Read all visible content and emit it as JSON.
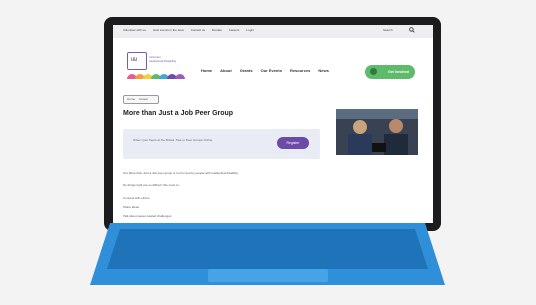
{
  "topbar": {
    "nav": [
      "Volunteer with us",
      "Host events in the area",
      "Contact us",
      "Donate",
      "Careers",
      "Login"
    ],
    "search_label": "Search"
  },
  "logo": {
    "box_text": "i&i",
    "line1": "Inclusion",
    "line2": "Intellectual Disability"
  },
  "mainnav": {
    "items": [
      "Home",
      "About",
      "Grants",
      "Our Events",
      "Resources",
      "News"
    ],
    "cta_label": "Get Involved"
  },
  "breadcrumb": {
    "items": [
      "Home",
      "Career"
    ]
  },
  "main": {
    "title": "More than Just a Job Peer Group",
    "banner_text": "When I join Peers at the Bristol, Tate or Peer Groups Online",
    "register_label": "Register",
    "intro": "Our More than Just a Job peer group is run for and by people with intellectual disability.",
    "prompt": "Do things right are so difficult. We meet to:",
    "bullets": [
      "Connect with others",
      "Share ideas",
      "Talk about career-related challenges"
    ]
  },
  "colors": {
    "bezel": "#1c1c1e",
    "accent_purple": "#6b4aa8",
    "cta_green": "#5dbb6b",
    "keyboard_blue": "#2f8fd9"
  }
}
